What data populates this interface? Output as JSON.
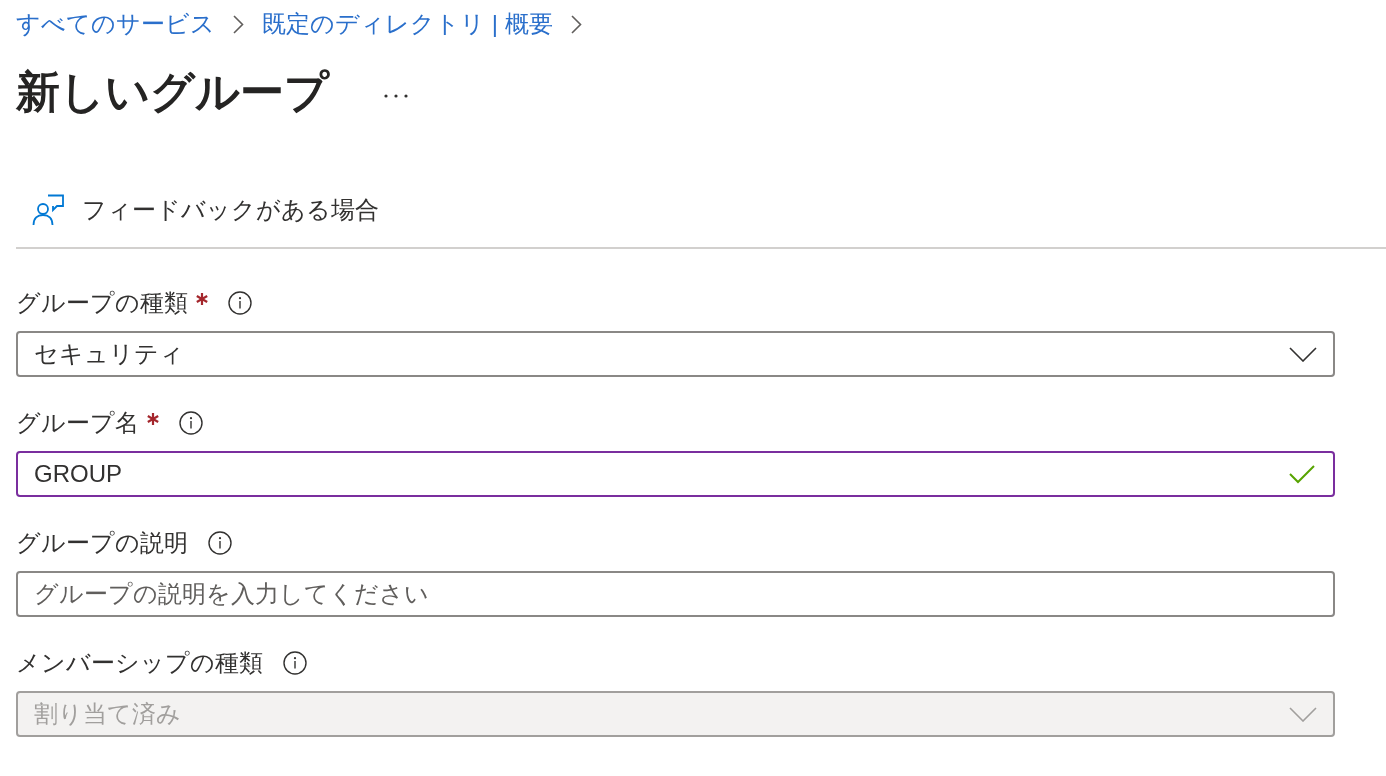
{
  "breadcrumb": [
    {
      "label": "すべてのサービス"
    },
    {
      "label": "既定のディレクトリ | 概要"
    }
  ],
  "page": {
    "title": "新しいグループ"
  },
  "feedback": {
    "label": "フィードバックがある場合"
  },
  "fields": [
    {
      "kind": "dropdown",
      "label": "グループの種類",
      "required": true,
      "value": "セキュリティ",
      "focused": false,
      "valid": false,
      "disabled": false
    },
    {
      "kind": "text",
      "label": "グループ名",
      "required": true,
      "value": "GROUP",
      "focused": true,
      "valid": true,
      "disabled": false
    },
    {
      "kind": "text",
      "label": "グループの説明",
      "required": false,
      "placeholder": "グループの説明を入力してください",
      "focused": false,
      "valid": false,
      "disabled": false
    },
    {
      "kind": "dropdown",
      "label": "メンバーシップの種類",
      "required": false,
      "value": "割り当て済み",
      "focused": false,
      "valid": false,
      "disabled": true
    }
  ]
}
